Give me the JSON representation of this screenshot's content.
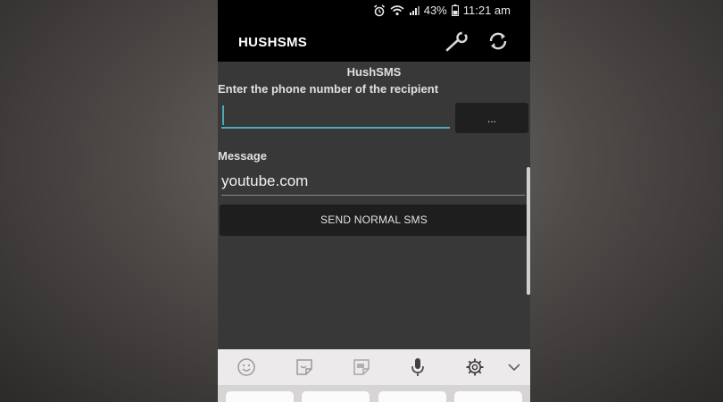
{
  "status_bar": {
    "battery": "43%",
    "time": "11:21 am",
    "icons": [
      "alarm-icon",
      "wifi-icon",
      "signal-icon",
      "battery-icon"
    ]
  },
  "app_bar": {
    "title": "HUSHSMS",
    "icons": [
      "wrench-icon",
      "refresh-icon"
    ]
  },
  "form": {
    "heading": "HushSMS",
    "phone_label": "Enter the phone number of the recipient",
    "phone_value": "",
    "contact_button": "...",
    "message_label": "Message",
    "message_value": "youtube.com",
    "send_button": "SEND NORMAL SMS"
  },
  "keyboard_toolbar": {
    "icons": [
      "emoji-icon",
      "sticker-icon",
      "gif-icon",
      "microphone-icon",
      "settings-icon",
      "collapse-chevron-icon"
    ]
  },
  "colors": {
    "accent": "#4fa9b8",
    "app_bar": "#000000",
    "background": "#383838",
    "button": "#1e1e1e"
  }
}
